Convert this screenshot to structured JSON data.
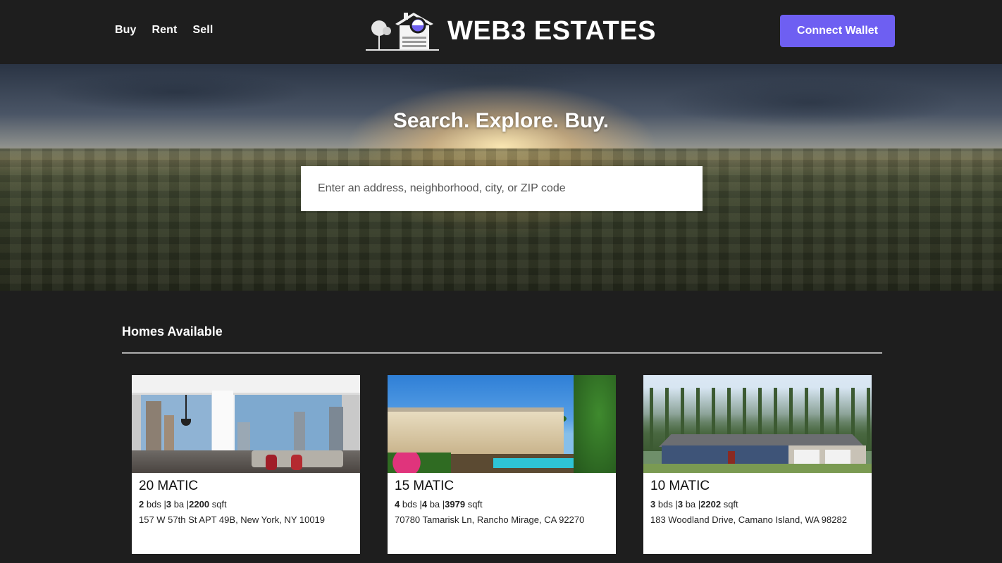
{
  "nav": {
    "links": [
      "Buy",
      "Rent",
      "Sell"
    ],
    "brand": "WEB3 ESTATES",
    "connect_label": "Connect Wallet"
  },
  "hero": {
    "title": "Search. Explore. Buy.",
    "search_placeholder": "Enter an address, neighborhood, city, or ZIP code"
  },
  "section": {
    "title": "Homes Available"
  },
  "homes": [
    {
      "price": "20 MATIC",
      "beds": "2",
      "beds_unit": "bds",
      "baths": "3",
      "baths_unit": "ba",
      "sqft": "2200",
      "sqft_unit": "sqft",
      "address": "157 W 57th St APT 49B, New York, NY 10019"
    },
    {
      "price": "15 MATIC",
      "beds": "4",
      "beds_unit": "bds",
      "baths": "4",
      "baths_unit": "ba",
      "sqft": "3979",
      "sqft_unit": "sqft",
      "address": "70780 Tamarisk Ln, Rancho Mirage, CA 92270"
    },
    {
      "price": "10 MATIC",
      "beds": "3",
      "beds_unit": "bds",
      "baths": "3",
      "baths_unit": "ba",
      "sqft": "2202",
      "sqft_unit": "sqft",
      "address": "183 Woodland Drive, Camano Island, WA 98282"
    }
  ],
  "colors": {
    "background": "#1e1e1e",
    "accent": "#6e5ff2",
    "card_bg": "#ffffff"
  }
}
